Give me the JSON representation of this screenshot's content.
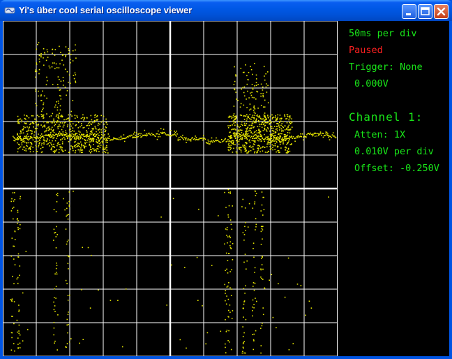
{
  "window": {
    "title": "Yi's über cool serial oscilloscope viewer",
    "buttons": {
      "minimize": "minimize",
      "maximize": "maximize",
      "close": "close"
    }
  },
  "status": {
    "timebase": "50ms per div",
    "run_state": "Paused",
    "trigger": "Trigger: None",
    "trigger_level": "0.000V"
  },
  "channel": {
    "heading": "Channel 1:",
    "atten": "Atten: 1X",
    "volts_per_div": "0.010V per div",
    "offset": "Offset: -0.250V"
  },
  "colors": {
    "text_green": "#19e619",
    "paused_red": "#ff2020",
    "trace_yellow": "#e6e600",
    "grid": "#ffffff",
    "background": "#000000"
  }
}
